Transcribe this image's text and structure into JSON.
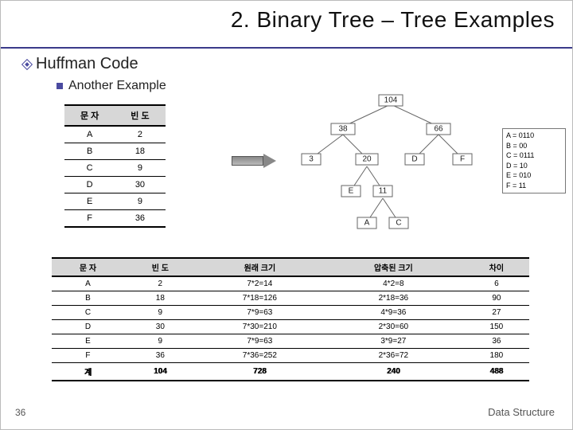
{
  "title": "2. Binary Tree – Tree Examples",
  "subtitle": "Huffman Code",
  "subsub": "Another Example",
  "table1": {
    "headers": [
      "문 자",
      "빈 도"
    ],
    "rows": [
      [
        "A",
        "2"
      ],
      [
        "B",
        "18"
      ],
      [
        "C",
        "9"
      ],
      [
        "D",
        "30"
      ],
      [
        "E",
        "9"
      ],
      [
        "F",
        "36"
      ]
    ]
  },
  "tree": {
    "root": "104",
    "l38": "38",
    "l66": "66",
    "l3": "3",
    "l20": "20",
    "D": "D",
    "F": "F",
    "E": "E",
    "l11": "11",
    "A": "A",
    "C": "C"
  },
  "codes": {
    "A": "A = 0110",
    "B": "B = 00",
    "C": "C = 0111",
    "D": "D = 10",
    "E": "E = 010",
    "F": "F = 11"
  },
  "table2": {
    "headers": [
      "문 자",
      "빈 도",
      "원래 크기",
      "압축된 크기",
      "차이"
    ],
    "rows": [
      [
        "A",
        "2",
        "7*2=14",
        "4*2=8",
        "6"
      ],
      [
        "B",
        "18",
        "7*18=126",
        "2*18=36",
        "90"
      ],
      [
        "C",
        "9",
        "7*9=63",
        "4*9=36",
        "27"
      ],
      [
        "D",
        "30",
        "7*30=210",
        "2*30=60",
        "150"
      ],
      [
        "E",
        "9",
        "7*9=63",
        "3*9=27",
        "36"
      ],
      [
        "F",
        "36",
        "7*36=252",
        "2*36=72",
        "180"
      ]
    ],
    "sum": [
      "계",
      "104",
      "728",
      "240",
      "488"
    ]
  },
  "page": "36",
  "footer": "Data Structure"
}
